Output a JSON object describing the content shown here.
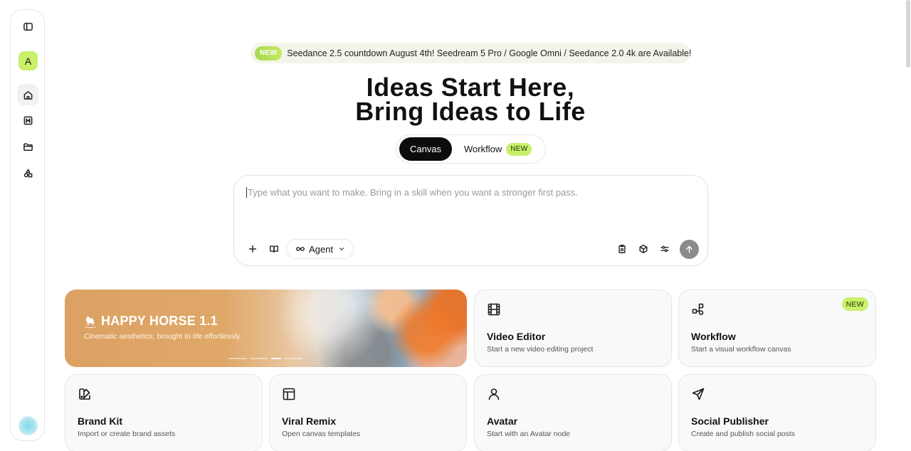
{
  "sidebar": {
    "avatar_letter": "A"
  },
  "announcement": {
    "badge": "NEW",
    "text": "Seedance 2.5 countdown August 4th! Seedream 5 Pro / Google Omni / Seedance 2.0 4k are Available!"
  },
  "hero": {
    "line1": "Ideas Start Here,",
    "line2": "Bring Ideas to Life"
  },
  "mode_toggle": {
    "canvas_label": "Canvas",
    "workflow_label": "Workflow",
    "workflow_badge": "NEW",
    "selected": "Canvas"
  },
  "prompt": {
    "placeholder": "Type what you want to make. Bring in a skill when you want a stronger first pass.",
    "value": "",
    "agent_label": "Agent"
  },
  "banner": {
    "title": "HAPPY HORSE 1.1",
    "subtitle": "Cinematic aesthetics, brought to life effortlessly.",
    "slide_count": 4,
    "active_slide": 3
  },
  "cards": [
    {
      "title": "Video Editor",
      "subtitle": "Start a new video editing project",
      "icon": "film-icon"
    },
    {
      "title": "Workflow",
      "subtitle": "Start a visual workflow canvas",
      "icon": "workflow-nodes-icon",
      "badge": "NEW"
    },
    {
      "title": "Brand Kit",
      "subtitle": "Import or create brand assets",
      "icon": "palette-swatch-icon"
    },
    {
      "title": "Viral Remix",
      "subtitle": "Open canvas templates",
      "icon": "layout-template-icon"
    },
    {
      "title": "Avatar",
      "subtitle": "Start with an Avatar node",
      "icon": "user-icon"
    },
    {
      "title": "Social Publisher",
      "subtitle": "Create and publish social posts",
      "icon": "send-icon"
    }
  ],
  "colors": {
    "accent_green": "#c8f06a",
    "primary_dark": "#0c0c0c",
    "send_button": "#8a8a8a"
  }
}
